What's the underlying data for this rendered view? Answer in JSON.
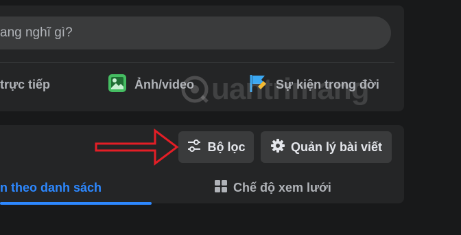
{
  "composer": {
    "placeholder": "ang nghĩ gì?",
    "actions": [
      {
        "label": "trực tiếp",
        "icon": "live-video-icon"
      },
      {
        "label": "Ảnh/video",
        "icon": "photo-video-icon",
        "color": "#45bd62"
      },
      {
        "label": "Sự kiện trong đời",
        "icon": "life-event-flag-icon",
        "color": "#3ba8f3"
      }
    ]
  },
  "posts": {
    "filter_label": "Bộ lọc",
    "manage_label": "Quản lý bài viết",
    "tabs": [
      {
        "label": "n theo danh sách",
        "active": true
      },
      {
        "label": "Chế độ xem lưới",
        "active": false
      }
    ]
  },
  "watermark": {
    "text": "uantrimang"
  },
  "colors": {
    "accent": "#2d88ff",
    "arrow": "#e41e26",
    "background": "#18191a",
    "card": "#242526",
    "button": "#3a3b3c"
  }
}
